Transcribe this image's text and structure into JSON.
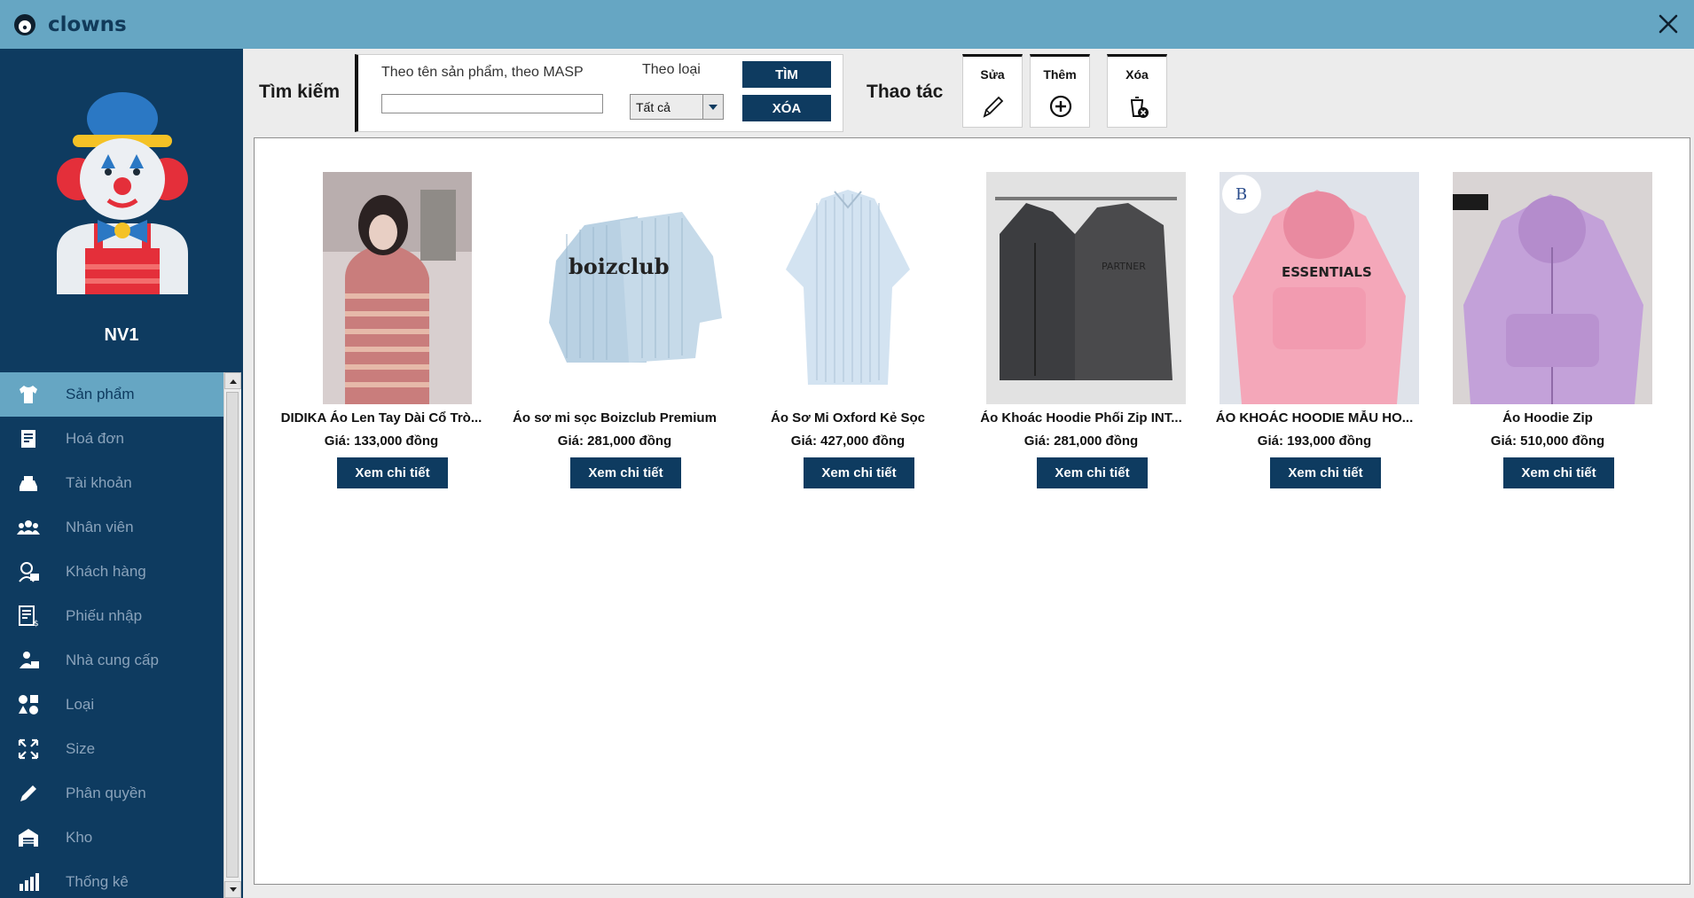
{
  "app": {
    "title": "clowns"
  },
  "user": {
    "name": "NV1"
  },
  "sidebar": {
    "items": [
      {
        "label": "Sản phẩm",
        "icon": "shirt-icon",
        "active": true
      },
      {
        "label": "Hoá đơn",
        "icon": "invoice-icon"
      },
      {
        "label": "Tài khoản",
        "icon": "account-icon"
      },
      {
        "label": "Nhân viên",
        "icon": "staff-icon"
      },
      {
        "label": "Khách hàng",
        "icon": "customer-icon"
      },
      {
        "label": "Phiếu nhập",
        "icon": "import-receipt-icon"
      },
      {
        "label": "Nhà cung cấp",
        "icon": "supplier-icon"
      },
      {
        "label": "Loại",
        "icon": "category-icon"
      },
      {
        "label": "Size",
        "icon": "resize-icon"
      },
      {
        "label": "Phân quyền",
        "icon": "pencil-icon"
      },
      {
        "label": "Kho",
        "icon": "warehouse-icon"
      },
      {
        "label": "Thống kê",
        "icon": "statistics-icon"
      }
    ]
  },
  "search": {
    "label": "Tìm kiếm",
    "name_label": "Theo tên sản phẩm, theo MASP",
    "name_value": "",
    "type_label": "Theo loại",
    "type_value": "Tất cả",
    "find_button": "TÌM",
    "clear_button": "XÓA"
  },
  "actions": {
    "label": "Thao tác",
    "edit": "Sửa",
    "add": "Thêm",
    "delete": "Xóa"
  },
  "products": [
    {
      "name": "DIDIKA Áo Len Tay Dài Cổ Trò...",
      "price": "Giá: 133,000 đồng",
      "button": "Xem chi tiết"
    },
    {
      "name": "Áo sơ mi sọc Boizclub Premium",
      "price": "Giá: 281,000 đồng",
      "button": "Xem chi tiết"
    },
    {
      "name": "Áo Sơ Mi Oxford Kẻ Sọc",
      "price": "Giá: 427,000 đồng",
      "button": "Xem chi tiết"
    },
    {
      "name": "Áo Khoác Hoodie Phối Zip INT...",
      "price": "Giá: 281,000 đồng",
      "button": "Xem chi tiết"
    },
    {
      "name": "ÁO KHOÁC HOODIE MẪU HO...",
      "price": "Giá: 193,000 đồng",
      "button": "Xem chi tiết"
    },
    {
      "name": "Áo Hoodie Zip",
      "price": "Giá: 510,000 đồng",
      "button": "Xem chi tiết"
    }
  ],
  "colors": {
    "titlebar": "#66a6c3",
    "sidebar": "#0e3b60",
    "accent_button": "#0e3b60"
  }
}
